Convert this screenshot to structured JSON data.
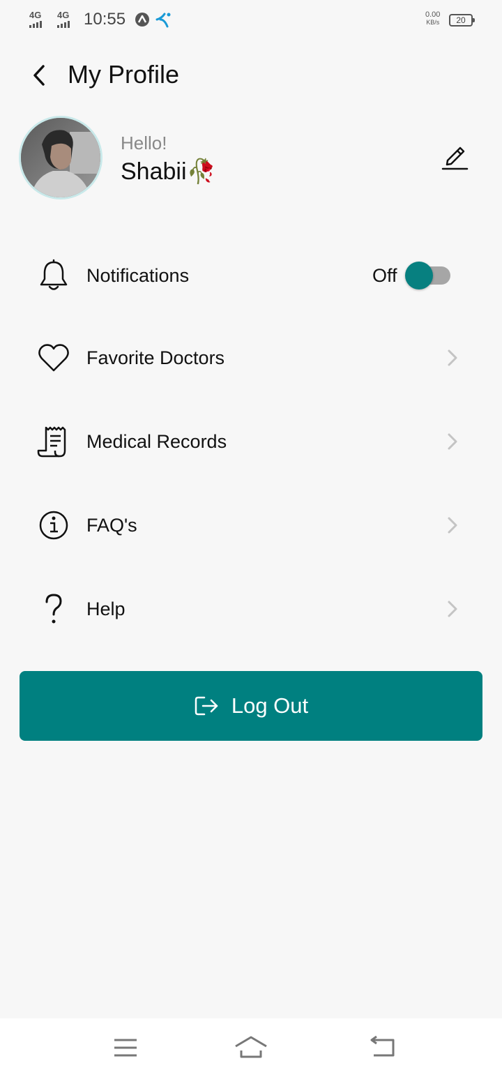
{
  "status_bar": {
    "network1": "4G",
    "network2": "4G",
    "time": "10:55",
    "speed_value": "0.00",
    "speed_unit": "KB/s",
    "battery": "20"
  },
  "header": {
    "title": "My Profile",
    "back_icon": "chevron-left-icon"
  },
  "profile": {
    "greeting": "Hello!",
    "name": "Shabii🥀",
    "edit_icon": "pencil-icon"
  },
  "menu": {
    "items": [
      {
        "label": "Notifications",
        "icon": "bell-icon",
        "toggle_state": "Off",
        "toggle_on": false
      },
      {
        "label": "Favorite Doctors",
        "icon": "heart-icon"
      },
      {
        "label": "Medical Records",
        "icon": "receipt-icon"
      },
      {
        "label": "FAQ's",
        "icon": "info-icon"
      },
      {
        "label": "Help",
        "icon": "question-icon"
      }
    ]
  },
  "logout": {
    "label": "Log Out",
    "icon": "logout-icon"
  },
  "nav_bar": {
    "items": [
      "menu-icon",
      "home-icon",
      "back-icon"
    ]
  },
  "colors": {
    "accent": "#008080",
    "background": "#f7f7f7",
    "toggle_track": "#a6a6a6"
  }
}
